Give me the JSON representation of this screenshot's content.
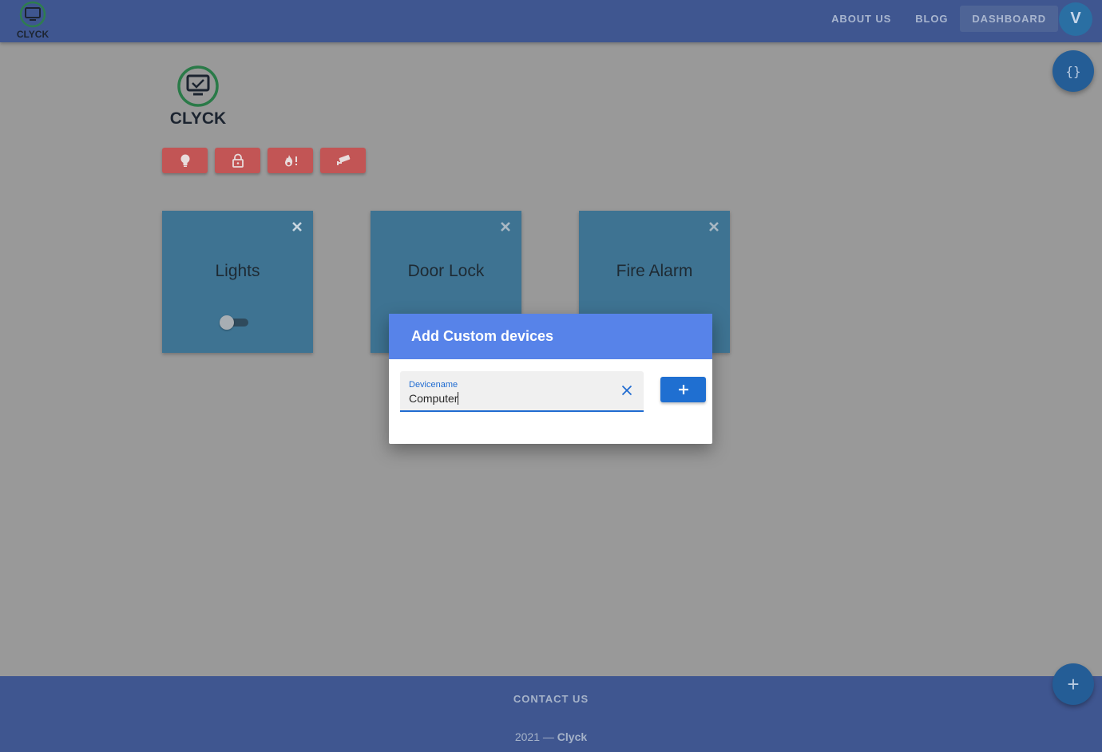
{
  "header": {
    "logo_text": "CLYCK",
    "nav": [
      {
        "label": "ABOUT US"
      },
      {
        "label": "BLOG"
      },
      {
        "label": "DASHBOARD",
        "active": true
      }
    ],
    "avatar_initial": "V"
  },
  "fab": {
    "code_icon": "{}",
    "add_icon": "+"
  },
  "main": {
    "logo_text": "CLYCK",
    "device_type_buttons": [
      {
        "icon": "lightbulb-icon"
      },
      {
        "icon": "lock-icon"
      },
      {
        "icon": "fire-alarm-icon"
      },
      {
        "icon": "security-camera-icon"
      }
    ],
    "cards": [
      {
        "title": "Lights",
        "has_toggle": true,
        "toggle_on": false
      },
      {
        "title": "Door Lock"
      },
      {
        "title": "Fire Alarm"
      }
    ]
  },
  "dialog": {
    "title": "Add Custom devices",
    "field_label": "Devicename",
    "field_value": "Computer",
    "add_button_icon": "+"
  },
  "footer": {
    "contact_label": "CONTACT US",
    "copyright_prefix": "2021 —",
    "copyright_brand": "Clyck"
  },
  "colors": {
    "header_bg": "#3f5690",
    "device_button": "#c25555",
    "card": "#4a88b2",
    "dialog_header": "#5783e9",
    "primary": "#1f6fd1"
  }
}
